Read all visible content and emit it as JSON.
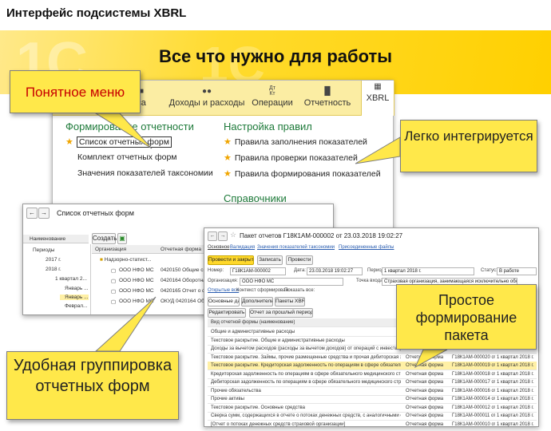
{
  "header": {
    "title": "Интерфейс подсистемы XBRL"
  },
  "banner": {
    "headline": "Все что нужно для работы",
    "watermark": "1С"
  },
  "main_window": {
    "sections": [
      {
        "label": "са",
        "icon": "document-icon"
      },
      {
        "label": "Доходы и расходы",
        "icon": "coins-icon"
      },
      {
        "label": "Операции",
        "icon": "dt-kt-icon",
        "icon_text": "Дт\nКт"
      },
      {
        "label": "Отчетность",
        "icon": "bar-chart-icon"
      },
      {
        "label": "XBRL",
        "icon": "xbrl-icon"
      }
    ],
    "group1": {
      "title": "Формирование отчетности",
      "items": [
        "Список отчетных форм",
        "Комплект отчетных форм",
        "Значения показателей таксономии"
      ]
    },
    "group2": {
      "title": "Настройка правил",
      "items": [
        "Правила заполнения показателей",
        "Правила проверки показателей",
        "Правила формирования показателей"
      ]
    },
    "group3": {
      "title": "Справочники"
    }
  },
  "callouts": {
    "menu": "Понятное меню",
    "integrate": "Легко интегрируется",
    "package": "Простое формирование пакета",
    "grouping": "Удобная группировка отчетных форм"
  },
  "list_window": {
    "title": "Список отчетных форм",
    "create_button": "Создать",
    "tree_header": "Наименование",
    "tree": [
      "Периоды",
      "2017 г.",
      "2018 г.",
      "1 квартал 2...",
      "Январь ...",
      "Январь ...",
      "Феврал..."
    ],
    "columns": [
      "Организация",
      "Отчетная форма"
    ],
    "folder_row": "Надзорно-статист...",
    "rows": [
      {
        "org": "ООО НФО МС",
        "form": "0420150 Общие свед"
      },
      {
        "org": "ООО НФО МС",
        "form": "0420164 Оборотная в"
      },
      {
        "org": "ООО НФО МС",
        "form": "0420165 Отчет о фин"
      },
      {
        "org": "ООО НФО МС",
        "form": "ОКУД 0420164 Оборо"
      }
    ]
  },
  "packet_window": {
    "title": "Пакет отчетов Г18К1АМ-000002 от 23.03.2018 19:02:27",
    "tabs": [
      "Основное",
      "Валидация",
      "Значения показателей таксономии",
      "Присоединенные файлы"
    ],
    "buttons": {
      "post_close": "Провести и закрыть",
      "save": "Записать",
      "post": "Провести"
    },
    "fields": {
      "number_label": "Номер:",
      "number": "Г18К1АМ-000002",
      "date_label": "Дата:",
      "date": "23.03.2018 19:02:27",
      "period_label": "Период:",
      "period": "1 квартал 2018 г.",
      "status_label": "Статус:",
      "status": "В работе",
      "org_label": "Организация:",
      "org": "ООО НФО МС",
      "entry_label": "Точка входа:",
      "entry": "Страховая организация, занимающаяся исключительно обяз..."
    },
    "checks": {
      "open": "Открытые все",
      "context": "Контекст сформирован",
      "show_all": "Показать все:"
    },
    "subtabs": [
      "Основные данные",
      "Дополнительно",
      "Пакеты XBRL"
    ],
    "sub_buttons": {
      "edit": "Редактировать",
      "prev_report": "Отчет за прошлый период"
    },
    "table_header": "Вид отчетной формы (наименование)",
    "rows": [
      {
        "name": "Общие и административные расходы",
        "type": "",
        "code": "",
        "period": ""
      },
      {
        "name": "Текстовое раскрытие. Общие и административные расходы",
        "type": "",
        "code": "",
        "period": ""
      },
      {
        "name": "Доходы за вычетом расходов (расходы за вычетом доходов) от операций с инвестиционным иму...",
        "type": "",
        "code": "",
        "period": ""
      },
      {
        "name": "Текстовое раскрытие. Займы, прочие размещенные средства и прочая дебиторская задолженность",
        "type": "Отчетная форма",
        "code": "Г18К1АМ-000020 от 03.0...",
        "period": "1 квартал 2018 г."
      },
      {
        "name": "Текстовое раскрытие. Кредиторская задолженность по операциям в сфере обязательного медици...",
        "type": "Отчетная форма",
        "code": "Г18К1АМ-000019 от 03.0...",
        "period": "1 квартал 2018 г."
      },
      {
        "name": "Кредиторская задолженность по операциям в сфере обязательного медицинского страхования",
        "type": "Отчетная форма",
        "code": "Г18К1АМ-000018 от 03.0...",
        "period": "1 квартал 2018 г."
      },
      {
        "name": "Дебиторская задолженность по операциям в сфере обязательного медицинского страхования",
        "type": "Отчетная форма",
        "code": "Г18К1АМ-000017 от 03.0...",
        "period": "1 квартал 2018 г."
      },
      {
        "name": "Прочие обязательства",
        "type": "Отчетная форма",
        "code": "Г18К1АМ-000016 от 03.0...",
        "period": "1 квартал 2018 г."
      },
      {
        "name": "Прочие активы",
        "type": "Отчетная форма",
        "code": "Г18К1АМ-000014 от 03.0...",
        "period": "1 квартал 2018 г."
      },
      {
        "name": "Текстовое раскрытие. Основные средства",
        "type": "Отчетная форма",
        "code": "Г18К1АМ-000012 от 03.0...",
        "period": "1 квартал 2018 г."
      },
      {
        "name": "Сверка сумм, содержащихся в отчете о потоках денежных средств, с аналогичными статьями, п...",
        "type": "Отчетная форма",
        "code": "Г18К1АМ-000011 от 03.0...",
        "period": "1 квартал 2018 г."
      },
      {
        "name": "[Отчет о потоках денежных средств страховой организации]",
        "type": "Отчетная форма",
        "code": "Г18К1АМ-000010 от 03.0...",
        "period": "1 квартал 2018 г."
      }
    ]
  },
  "colors": {
    "accent_yellow": "#ffe84a",
    "menu_text": "#c80000",
    "group_green": "#1e7a3a",
    "star": "#f0a500",
    "banner": "#ffd000"
  }
}
